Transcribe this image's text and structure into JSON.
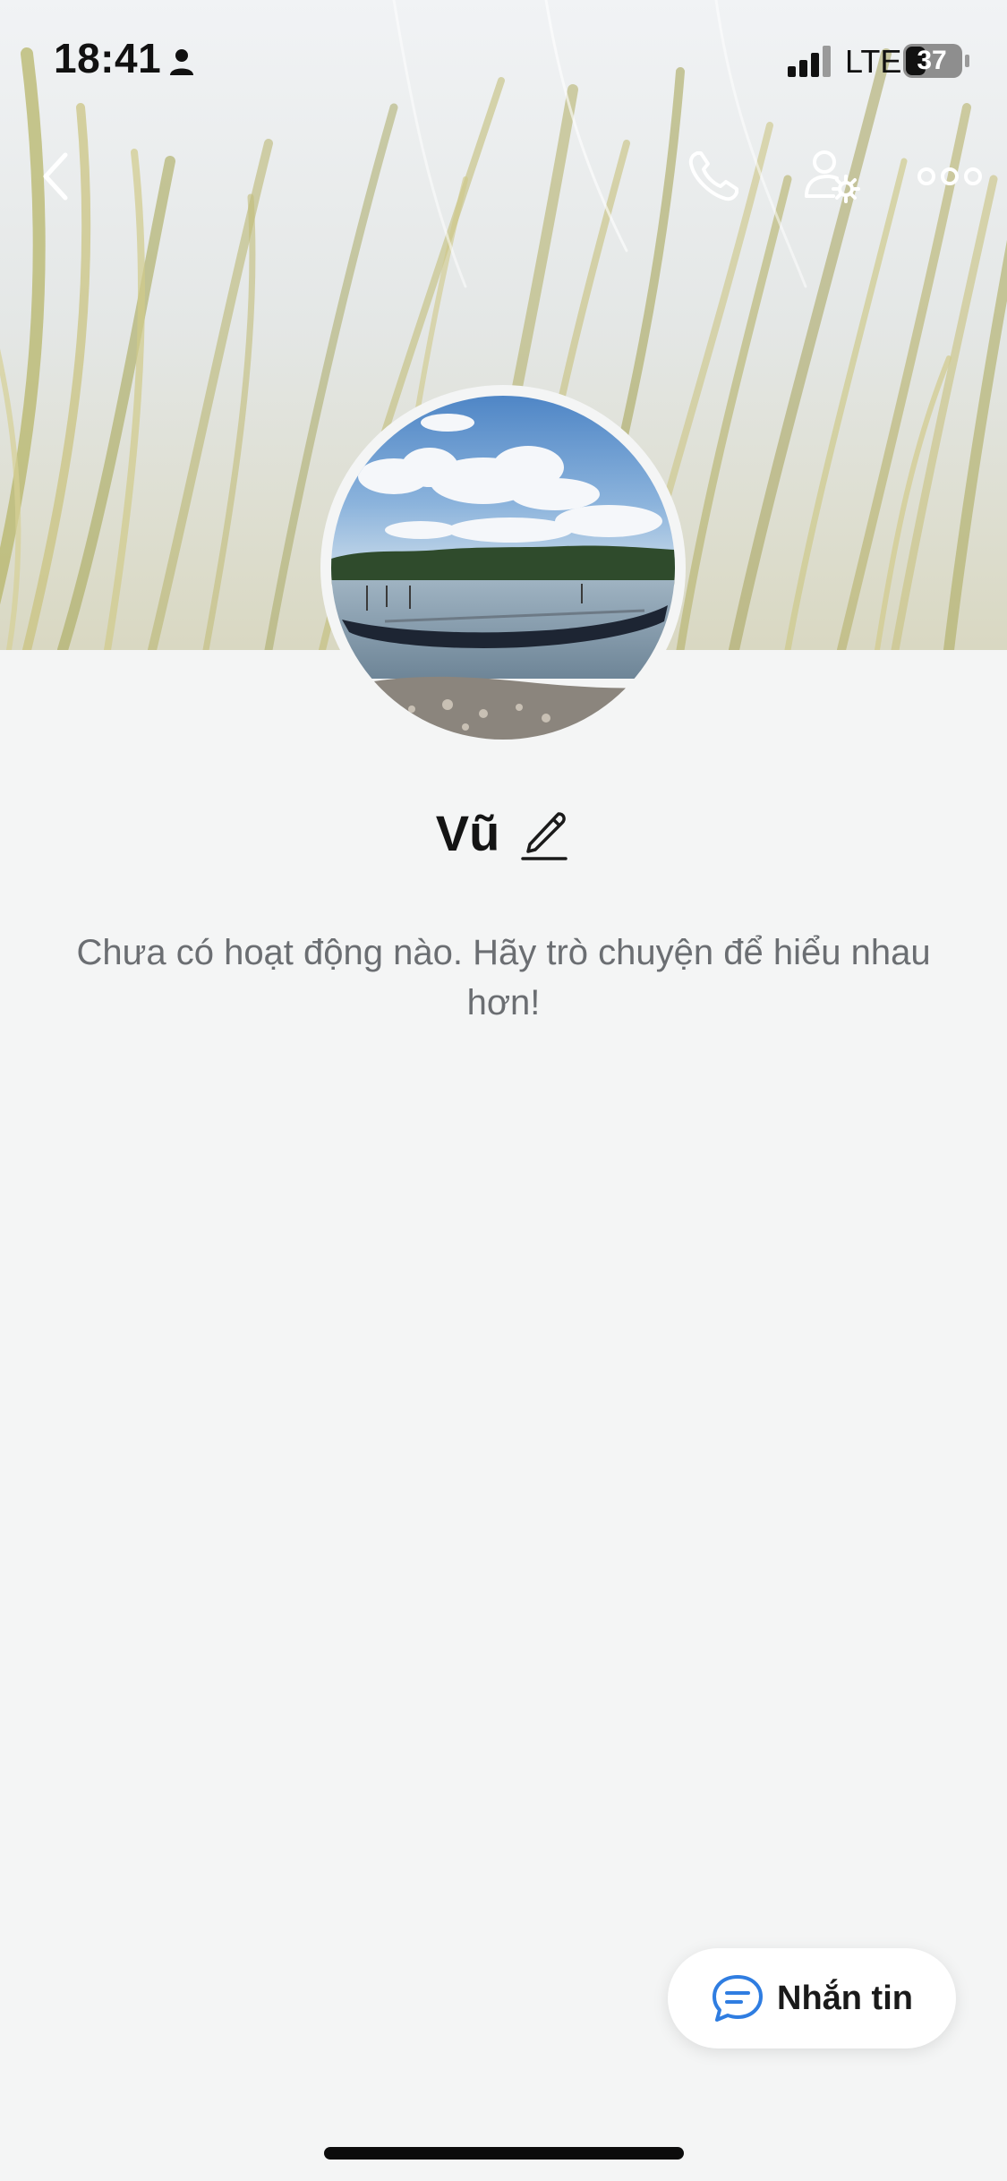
{
  "status_bar": {
    "time": "18:41",
    "network": "LTE",
    "battery_level": "37",
    "icons": [
      "person-icon",
      "signal-icon",
      "battery-icon"
    ]
  },
  "header": {
    "icons": [
      "chevron-left-icon",
      "phone-icon",
      "user-gear-icon",
      "ellipsis-icon"
    ]
  },
  "profile": {
    "name": "Vũ",
    "empty_activity": "Chưa có hoạt động nào. Hãy trò chuyện để hiểu nhau hơn!"
  },
  "actions": {
    "message_label": "Nhắn tin",
    "message_icon": "chat-bubble-icon"
  },
  "colors": {
    "background": "#f4f5f5",
    "accent": "#2f7de1",
    "text_primary": "#141414",
    "text_secondary": "#6b6e72"
  }
}
